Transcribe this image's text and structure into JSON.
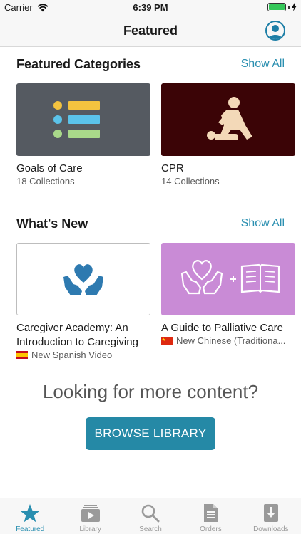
{
  "status_bar": {
    "carrier": "Carrier",
    "time": "6:39 PM"
  },
  "nav": {
    "title": "Featured"
  },
  "featured_categories": {
    "title": "Featured Categories",
    "show_all": "Show All",
    "items": [
      {
        "title": "Goals of Care",
        "subtitle": "18 Collections",
        "thumb_color": "#555a61"
      },
      {
        "title": "CPR",
        "subtitle": "14 Collections",
        "thumb_color": "#3b0406"
      }
    ]
  },
  "whats_new": {
    "title": "What's New",
    "show_all": "Show All",
    "items": [
      {
        "title_line1": "Caregiver Academy: An",
        "title_line2": "Introduction to Caregiving",
        "subtitle": "New Spanish Video",
        "flag": "spain-flag",
        "thumb_color": "#ffffff"
      },
      {
        "title_line1": "A Guide to Palliative Care",
        "subtitle": "New Chinese (Traditiona...",
        "flag": "china-flag",
        "thumb_color": "#c98bd6"
      }
    ]
  },
  "more_content": {
    "title": "Looking for more content?",
    "button": "BROWSE LIBRARY"
  },
  "tabs": [
    {
      "label": "Featured",
      "icon": "star-icon",
      "active": true
    },
    {
      "label": "Library",
      "icon": "library-icon",
      "active": false
    },
    {
      "label": "Search",
      "icon": "search-icon",
      "active": false
    },
    {
      "label": "Orders",
      "icon": "document-icon",
      "active": false
    },
    {
      "label": "Downloads",
      "icon": "download-icon",
      "active": false
    }
  ],
  "colors": {
    "accent": "#2a8fb0",
    "button": "#2589a6",
    "tab_inactive": "#9a9a9a"
  }
}
